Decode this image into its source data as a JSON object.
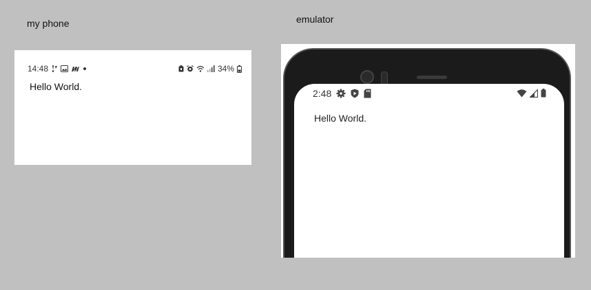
{
  "captions": {
    "phone": "my phone",
    "emulator": "emulator"
  },
  "phone": {
    "status": {
      "time": "14:48",
      "battery_percent": "34%",
      "left_icons": [
        "pin-icon",
        "image-icon",
        "m-app-icon",
        "dot-icon"
      ],
      "right_icons": [
        "battery-saver-icon",
        "alarm-icon",
        "wifi-icon",
        "signal-icon",
        "battery-icon"
      ]
    },
    "content": {
      "hello": "Hello World."
    }
  },
  "emulator": {
    "status": {
      "time": "2:48",
      "left_icons": [
        "settings-icon",
        "shield-icon",
        "sd-card-icon"
      ],
      "right_icons": [
        "wifi-icon",
        "signal-icon",
        "battery-icon"
      ]
    },
    "content": {
      "hello": "Hello World."
    }
  },
  "colors": {
    "background": "#c0c0c0",
    "device_frame": "#1b1b1b",
    "screen": "#ffffff"
  }
}
